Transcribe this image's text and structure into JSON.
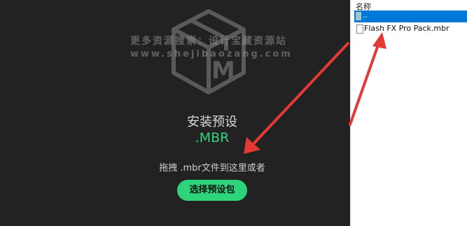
{
  "installer": {
    "watermark_line1": "更多资源搜索：设计宝藏资源站",
    "watermark_line2": "www.shejibaozang.com",
    "title": "安装预设",
    "extension": ".MBR",
    "drag_hint": "拖拽 .mbr文件到这里或者",
    "choose_button_label": "选择预设包",
    "accent_color": "#2ed47a",
    "background_color": "#222222"
  },
  "explorer": {
    "column_header": "名称",
    "parent_row_label": "..",
    "files": [
      {
        "name": "Flash FX Pro Pack.mbr",
        "icon": "file-icon"
      }
    ],
    "selection_color": "#0078d7"
  },
  "annotations": {
    "arrow_color": "#e53935",
    "icon": "red-arrow-icon"
  }
}
